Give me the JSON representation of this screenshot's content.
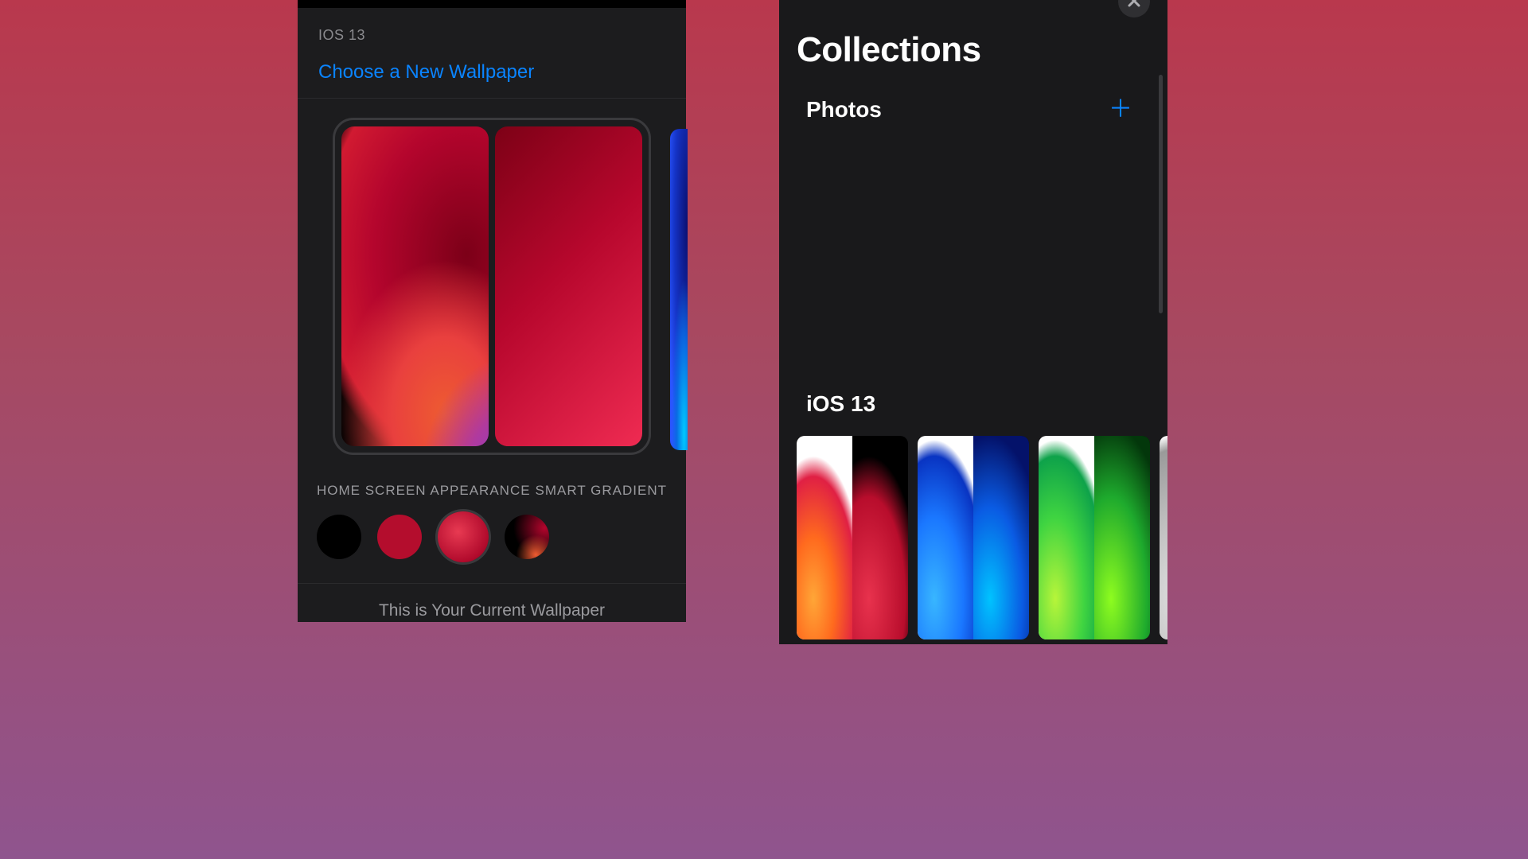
{
  "left": {
    "section_label": "IOS 13",
    "choose_link": "Choose a New Wallpaper",
    "home_screen_label": "HOME SCREEN APPEARANCE",
    "smart_gradient_label": "SMART GRADIENT",
    "swatches": [
      {
        "id": "solid-black",
        "selected": false
      },
      {
        "id": "solid-crimson",
        "selected": false
      },
      {
        "id": "gradient-red",
        "selected": true
      },
      {
        "id": "smart-gradient",
        "selected": false
      }
    ],
    "footer": "This is Your Current Wallpaper"
  },
  "right": {
    "title": "Collections",
    "photos_label": "Photos",
    "ios_label": "iOS 13",
    "strip": [
      {
        "id": "ios13-red"
      },
      {
        "id": "ios13-blue"
      },
      {
        "id": "ios13-green"
      },
      {
        "id": "ios13-grey"
      }
    ]
  }
}
